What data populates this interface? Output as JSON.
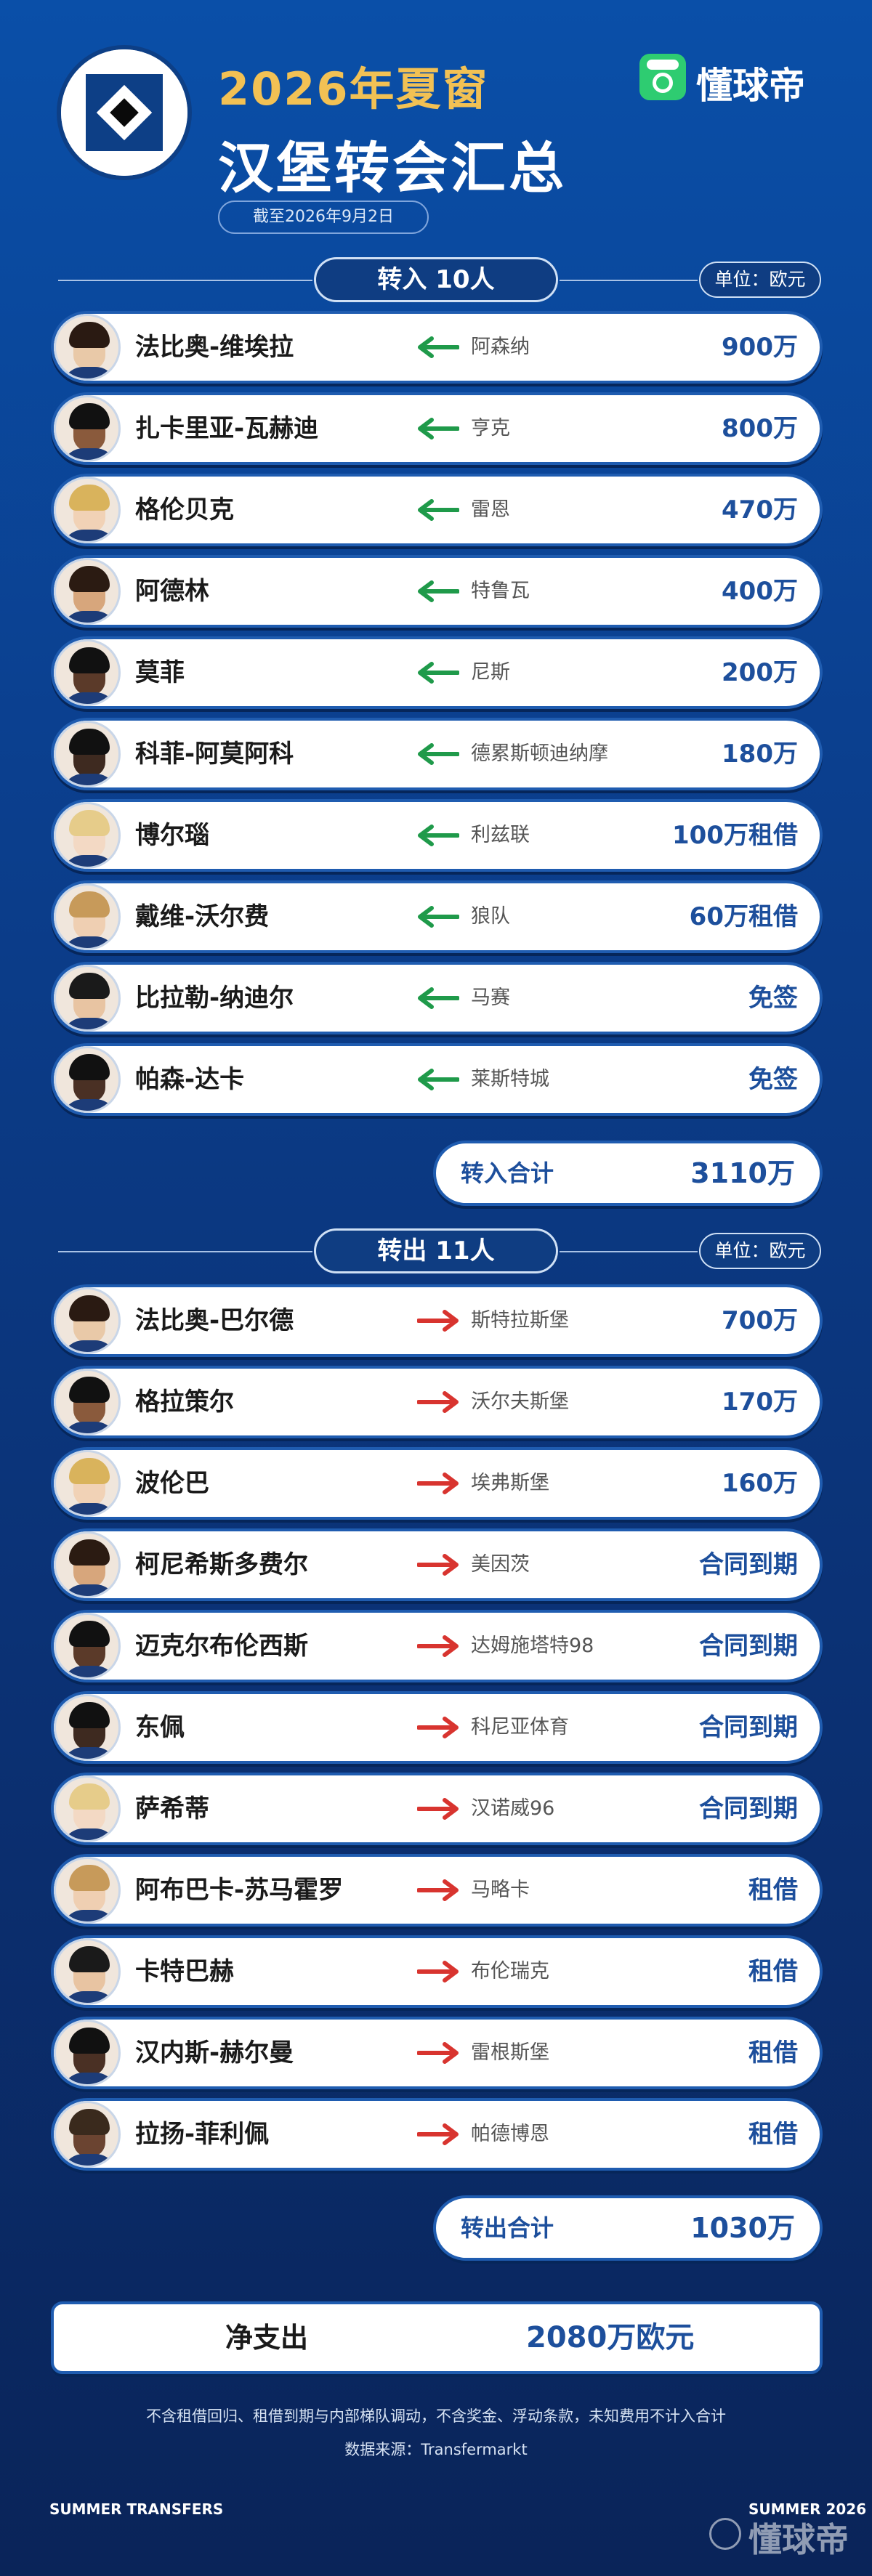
{
  "header": {
    "title_top": "2026年夏窗",
    "title_main": "汉堡转会汇总",
    "date": "截至2026年9月2日",
    "brand": "懂球帝"
  },
  "incoming": {
    "section_label": "转入 10人",
    "unit": "单位：欧元",
    "total_label": "转入合计",
    "total_value": "3110万",
    "rows": [
      {
        "name": "法比奥-维埃拉",
        "club": "阿森纳",
        "fee": "900万"
      },
      {
        "name": "扎卡里亚-瓦赫迪",
        "club": "亨克",
        "fee": "800万"
      },
      {
        "name": "格伦贝克",
        "club": "雷恩",
        "fee": "470万"
      },
      {
        "name": "阿德林",
        "club": "特鲁瓦",
        "fee": "400万"
      },
      {
        "name": "莫菲",
        "club": "尼斯",
        "fee": "200万"
      },
      {
        "name": "科菲-阿莫阿科",
        "club": "德累斯顿迪纳摩",
        "fee": "180万"
      },
      {
        "name": "博尔瑙",
        "club": "利兹联",
        "fee": "100万租借"
      },
      {
        "name": "戴维-沃尔费",
        "club": "狼队",
        "fee": "60万租借"
      },
      {
        "name": "比拉勒-纳迪尔",
        "club": "马赛",
        "fee": "免签"
      },
      {
        "name": "帕森-达卡",
        "club": "莱斯特城",
        "fee": "免签"
      }
    ]
  },
  "outgoing": {
    "section_label": "转出 11人",
    "unit": "单位：欧元",
    "total_label": "转出合计",
    "total_value": "1030万",
    "rows": [
      {
        "name": "法比奥-巴尔德",
        "club": "斯特拉斯堡",
        "fee": "700万"
      },
      {
        "name": "格拉策尔",
        "club": "沃尔夫斯堡",
        "fee": "170万"
      },
      {
        "name": "波伦巴",
        "club": "埃弗斯堡",
        "fee": "160万"
      },
      {
        "name": "柯尼希斯多费尔",
        "club": "美因茨",
        "fee": "合同到期"
      },
      {
        "name": "迈克尔布伦西斯",
        "club": "达姆施塔特98",
        "fee": "合同到期"
      },
      {
        "name": "东佩",
        "club": "科尼亚体育",
        "fee": "合同到期"
      },
      {
        "name": "萨希蒂",
        "club": "汉诺威96",
        "fee": "合同到期"
      },
      {
        "name": "阿布巴卡-苏马霍罗",
        "club": "马略卡",
        "fee": "租借"
      },
      {
        "name": "卡特巴赫",
        "club": "布伦瑞克",
        "fee": "租借"
      },
      {
        "name": "汉内斯-赫尔曼",
        "club": "雷根斯堡",
        "fee": "租借"
      },
      {
        "name": "拉扬-菲利佩",
        "club": "帕德博恩",
        "fee": "租借"
      }
    ]
  },
  "net": {
    "label": "净支出",
    "value": "2080万欧元"
  },
  "notes": {
    "line1": "不含租借回归、租借到期与内部梯队调动，不含奖金、浮动条款，未知费用不计入合计",
    "line2": "数据来源：Transfermarkt"
  },
  "footer": {
    "left": "SUMMER TRANSFERS",
    "right": "SUMMER 2026",
    "watermark": "懂球帝"
  },
  "colors": {
    "in_arrow": "#1f9a4a",
    "out_arrow": "#d8342f",
    "fee": "#1d4f9c",
    "accent_gold": "#f2c154"
  }
}
